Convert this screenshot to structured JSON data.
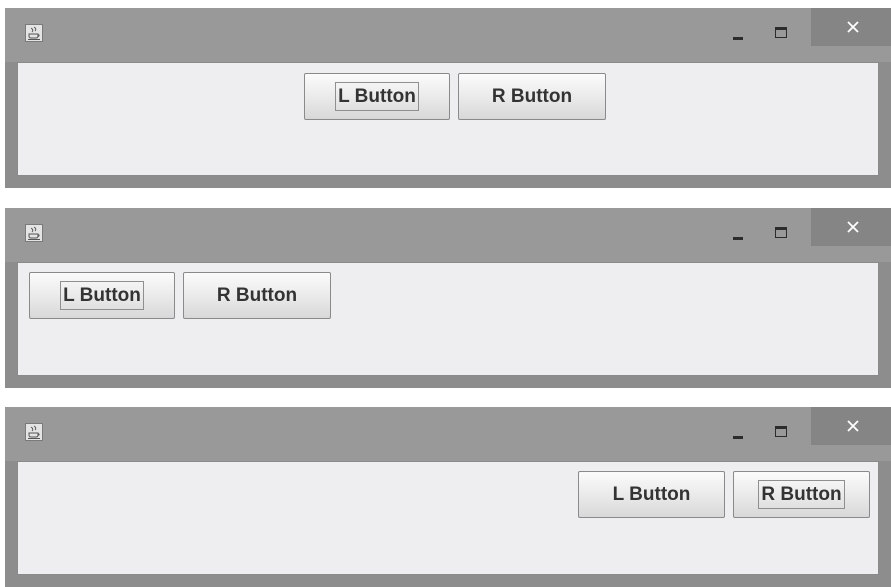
{
  "windows": [
    {
      "alignment": "center",
      "left_button": {
        "label": "L Button",
        "focused": true
      },
      "right_button": {
        "label": "R Button",
        "focused": false
      }
    },
    {
      "alignment": "left",
      "left_button": {
        "label": "L Button",
        "focused": true
      },
      "right_button": {
        "label": "R Button",
        "focused": false
      }
    },
    {
      "alignment": "right",
      "left_button": {
        "label": "L Button",
        "focused": false
      },
      "right_button": {
        "label": "R Button",
        "focused": true
      }
    }
  ],
  "titlebar": {
    "app_icon": "java-cup-icon",
    "controls": [
      "minimize-icon",
      "maximize-icon",
      "close-icon"
    ]
  },
  "colors": {
    "title_bar": "#999999",
    "close_button": "#858585",
    "content_background": "#eeeef0",
    "button_text": "#333333"
  }
}
